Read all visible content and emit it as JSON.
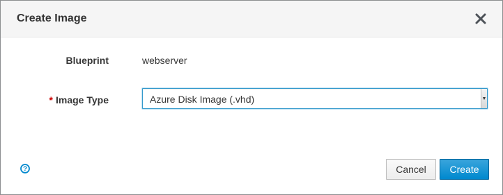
{
  "dialog": {
    "title": "Create Image",
    "close_icon": "close-icon"
  },
  "form": {
    "blueprint": {
      "label": "Blueprint",
      "value": "webserver"
    },
    "image_type": {
      "required_marker": "*",
      "label": "Image Type",
      "selected": "Azure Disk Image (.vhd)"
    }
  },
  "footer": {
    "help_icon": "help-icon",
    "cancel_label": "Cancel",
    "create_label": "Create"
  },
  "colors": {
    "primary": "#0088ce",
    "required": "#cc0000",
    "header_bg": "#f5f5f5"
  }
}
